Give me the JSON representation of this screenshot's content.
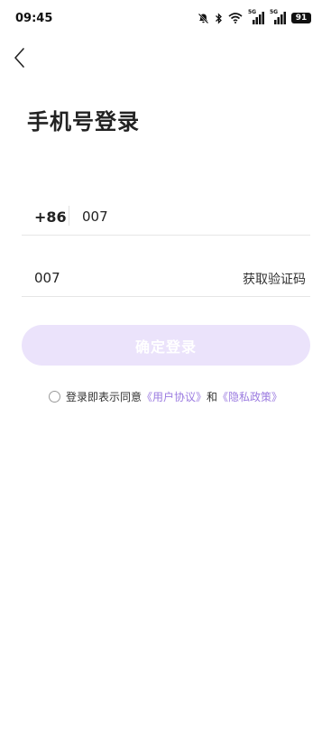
{
  "status_bar": {
    "time": "09:45",
    "signal_1_label": "5G",
    "signal_2_label": "5G",
    "battery": "91"
  },
  "page": {
    "title": "手机号登录"
  },
  "phone": {
    "country_code": "+86",
    "value": "007"
  },
  "code": {
    "value": "007",
    "get_code_label": "获取验证码"
  },
  "confirm_button": {
    "label": "确定登录"
  },
  "agreement": {
    "prefix": "登录即表示同意",
    "user_agreement": "《用户协议》",
    "and": "和",
    "privacy_policy": "《隐私政策》"
  },
  "colors": {
    "accent": "#9b7be0",
    "button_disabled_bg": "#ebe3fb"
  }
}
